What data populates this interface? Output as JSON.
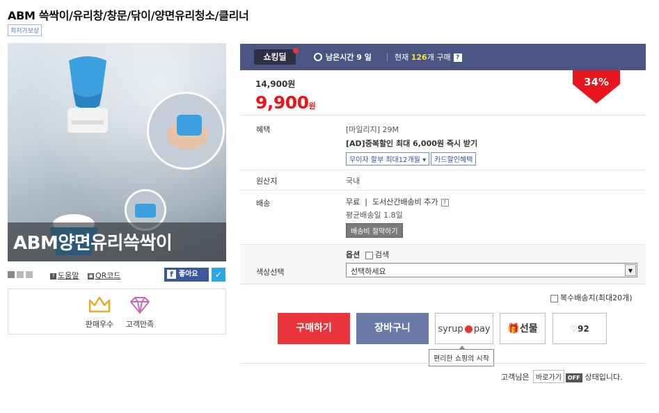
{
  "product": {
    "title": "ABM 쓱싹이/유리창/창문/닦이/양면유리청소/클리너",
    "lowest_price_badge": "최저가보상",
    "image_caption": "ABM양면유리쓱싹이"
  },
  "left_links": {
    "help": "도움말",
    "qr": "QR코드",
    "like": "좋아요"
  },
  "awards": [
    {
      "label": "판매우수",
      "icon": "crown-icon"
    },
    {
      "label": "고객만족",
      "icon": "diamond-icon"
    }
  ],
  "deal": {
    "logo": "쇼킹딜",
    "time_label": "남은시간 9 일",
    "count_prefix": "현재 ",
    "count": "126",
    "count_suffix": "개 구매",
    "help": "?"
  },
  "price": {
    "original": "14,900원",
    "sale": "9,900",
    "sale_unit": "원",
    "discount": "34%"
  },
  "benefits": {
    "label": "혜택",
    "mileage": "[마일리지] 29M",
    "ad_discount": "[AD]중복할인 최대 6,000원 즉시 받기",
    "installment": "무이자 할부 최대12개월",
    "card": "카드할인혜택"
  },
  "origin": {
    "label": "원산지",
    "value": "국내"
  },
  "shipping": {
    "label": "배송",
    "free": "무료",
    "extra": "도서산간배송비 추가",
    "avg": "평균배송일 1.8일",
    "save_btn": "배송비 절약하기"
  },
  "option": {
    "label": "색상선택",
    "header": "옵션",
    "search": "검색",
    "select_placeholder": "선택하세요"
  },
  "multi_ship": "복수배송지(최대20개)",
  "actions": {
    "buy": "구매하기",
    "cart": "장바구니",
    "syrup_left": "syrup",
    "syrup_right": "pay",
    "gift": "선물",
    "like_count": "92",
    "tooltip": "편리한 쇼핑의 시작"
  },
  "shortcut": {
    "prefix": "고객님은",
    "go": "바로가기",
    "off": "OFF",
    "suffix": "상태입니다."
  },
  "colors": {
    "deal_bar": "#4a5583",
    "sale_price": "#e8151d",
    "buy_button": "#e8343b",
    "cart_button": "#6b7aa7"
  }
}
